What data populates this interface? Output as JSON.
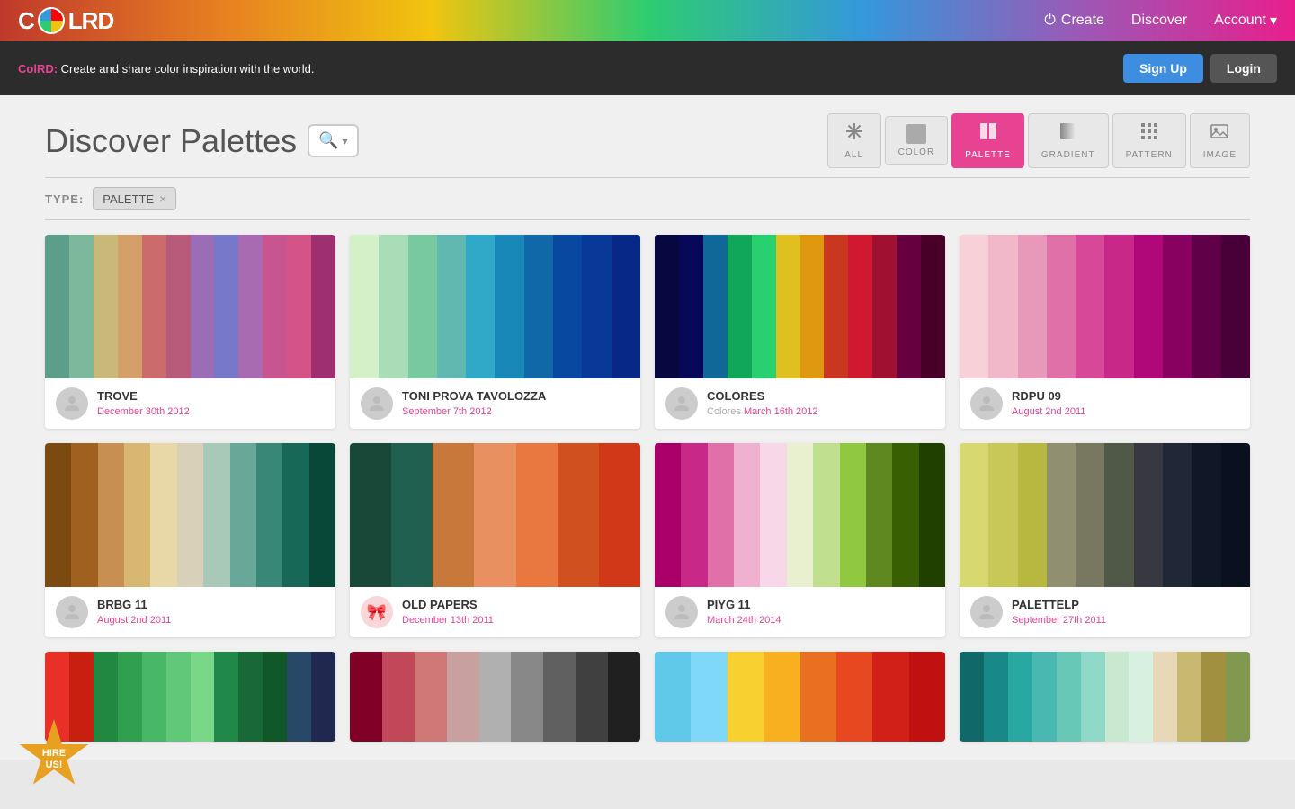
{
  "header": {
    "logo_text_left": "C",
    "logo_text_right": "LRD",
    "nav": {
      "create": "Create",
      "discover": "Discover",
      "account": "Account"
    }
  },
  "banner": {
    "brand": "ColRD:",
    "text": " Create and share color inspiration with the world.",
    "signup": "Sign Up",
    "login": "Login"
  },
  "page": {
    "title": "Discover Palettes",
    "search_placeholder": "Search"
  },
  "filter_tabs": [
    {
      "id": "all",
      "label": "ALL",
      "icon": "✳"
    },
    {
      "id": "color",
      "label": "COLOR",
      "icon": "▪"
    },
    {
      "id": "palette",
      "label": "PALETTE",
      "icon": "▌▌"
    },
    {
      "id": "gradient",
      "label": "GRADIENT",
      "icon": "▄"
    },
    {
      "id": "pattern",
      "label": "PATTERN",
      "icon": "⊞"
    },
    {
      "id": "image",
      "label": "IMAGE",
      "icon": "🖼"
    }
  ],
  "type_filter": {
    "label": "TYPE:",
    "active_tag": "PALETTE"
  },
  "palettes": [
    {
      "id": "trove",
      "name": "TROVE",
      "subtitle": "",
      "date": "December 30th 2012",
      "avatar_type": "person",
      "colors": [
        "#5c9e8a",
        "#7db89c",
        "#c8b97a",
        "#d4a06a",
        "#cc6b6b",
        "#b85a7a",
        "#9b6db5",
        "#7878c8",
        "#a86ab0",
        "#c85490",
        "#d45488",
        "#9e3070"
      ]
    },
    {
      "id": "toni-prova",
      "name": "TONI PROVA TAVOLOZZA",
      "subtitle": "",
      "date": "September 7th 2012",
      "avatar_type": "person",
      "colors": [
        "#d4f0c8",
        "#a8ddb8",
        "#78c8a0",
        "#60b8b0",
        "#30a8c8",
        "#1888b8",
        "#1068a8",
        "#0848a0",
        "#083898",
        "#082888"
      ]
    },
    {
      "id": "colores",
      "name": "COLORES",
      "subtitle": "Colores",
      "date": "March 16th 2012",
      "avatar_type": "person",
      "colors": [
        "#080840",
        "#080858",
        "#106898",
        "#10a858",
        "#28d070",
        "#e0c020",
        "#e09810",
        "#c83820",
        "#d01830",
        "#a01030",
        "#680040",
        "#480028"
      ]
    },
    {
      "id": "rdpu09",
      "name": "RDPU 09",
      "subtitle": "",
      "date": "August 2nd 2011",
      "avatar_type": "person",
      "colors": [
        "#f8d0d8",
        "#f0b8c8",
        "#e898b8",
        "#e070a8",
        "#d84898",
        "#c82888",
        "#b00878",
        "#880060",
        "#600048",
        "#480038"
      ]
    },
    {
      "id": "brbg11",
      "name": "BRBG 11",
      "subtitle": "",
      "date": "August 2nd 2011",
      "avatar_type": "person",
      "colors": [
        "#7a4a10",
        "#a06020",
        "#c89050",
        "#d8b870",
        "#e8d8a8",
        "#d8d0b8",
        "#a8c8b8",
        "#68a898",
        "#388878",
        "#186858",
        "#084838"
      ]
    },
    {
      "id": "old-papers",
      "name": "OLD PAPERS",
      "subtitle": "",
      "date": "December 13th 2011",
      "avatar_type": "ribbon",
      "colors": [
        "#184838",
        "#206050",
        "#c8783a",
        "#e89060",
        "#e87840",
        "#d05020",
        "#d03818"
      ]
    },
    {
      "id": "piyg11",
      "name": "PIYG 11",
      "subtitle": "",
      "date": "March 24th 2014",
      "avatar_type": "person",
      "colors": [
        "#a80068",
        "#c82888",
        "#e070a8",
        "#f0b0d0",
        "#f8d8e8",
        "#e8f0d0",
        "#c0e090",
        "#90c840",
        "#608820",
        "#386000",
        "#204000"
      ]
    },
    {
      "id": "palettelp",
      "name": "PALETTELP",
      "subtitle": "",
      "date": "September 27th 2011",
      "avatar_type": "person",
      "colors": [
        "#d8d870",
        "#c8c858",
        "#b8b840",
        "#909070",
        "#787860",
        "#505848",
        "#383840",
        "#202838",
        "#101828",
        "#0a1020"
      ]
    },
    {
      "id": "partial1",
      "name": "",
      "subtitle": "",
      "date": "",
      "avatar_type": "none",
      "partial": true,
      "colors": [
        "#e83028",
        "#c82010",
        "#208840",
        "#30a050",
        "#48b868",
        "#60c878",
        "#78d888",
        "#208848",
        "#186838",
        "#105828",
        "#284868",
        "#202850"
      ]
    },
    {
      "id": "partial2",
      "name": "",
      "subtitle": "",
      "date": "",
      "avatar_type": "none",
      "partial": true,
      "colors": [
        "#800028",
        "#c04858",
        "#d07878",
        "#c8a0a0",
        "#b0b0b0",
        "#888888",
        "#606060",
        "#404040",
        "#202020"
      ]
    },
    {
      "id": "partial3",
      "name": "",
      "subtitle": "",
      "date": "",
      "avatar_type": "none",
      "partial": true,
      "colors": [
        "#60c8e8",
        "#80d8f8",
        "#f8d030",
        "#f8b020",
        "#e87020",
        "#e84820",
        "#d02018",
        "#c01010"
      ]
    },
    {
      "id": "partial4",
      "name": "",
      "subtitle": "",
      "date": "",
      "avatar_type": "none",
      "partial": true,
      "colors": [
        "#106868",
        "#188888",
        "#28a8a0",
        "#48b8b0",
        "#68c8b8",
        "#90d8c8",
        "#c8e8d0",
        "#d8f0e0",
        "#e8d8b8",
        "#c8b870",
        "#a09040",
        "#809850"
      ]
    }
  ],
  "hire_badge": {
    "line1": "HIRE",
    "line2": "US!"
  }
}
